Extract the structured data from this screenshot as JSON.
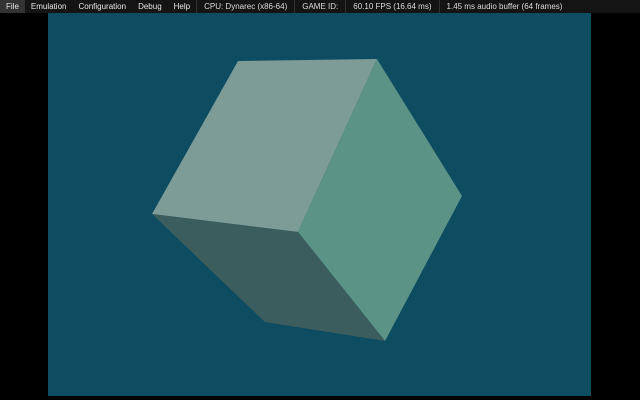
{
  "menu_bar": {
    "menus": [
      {
        "label": "File"
      },
      {
        "label": "Emulation"
      },
      {
        "label": "Configuration"
      },
      {
        "label": "Debug"
      },
      {
        "label": "Help"
      }
    ],
    "status_items": [
      {
        "label": "CPU: Dynarec (x86-64)"
      },
      {
        "label": "GAME ID:"
      },
      {
        "label": "60.10 FPS (16.64 ms)"
      },
      {
        "label": "1.45 ms audio buffer (64 frames)"
      }
    ]
  },
  "viewport": {
    "background_color": "#0e4c61",
    "cube": {
      "top_face_color": "#7d9c98",
      "right_face_color": "#5b9386",
      "front_face_color": "#3c5d5e"
    }
  },
  "colors": {
    "menu_bar_bg": "#141414",
    "letterbox": "#000000"
  }
}
